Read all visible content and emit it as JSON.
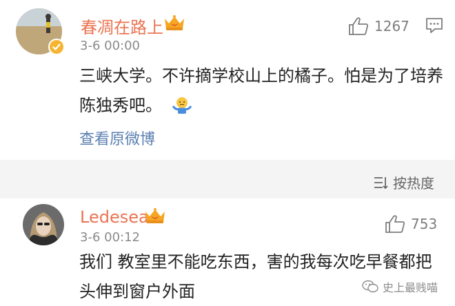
{
  "comments": [
    {
      "username": "春凋在路上",
      "time": "3-6 00:00",
      "likes": "1267",
      "text": "三峡大学。不许摘学校山上的橘子。怕是为了培养陈独秀吧。",
      "view_original": "查看原微博",
      "verified": true,
      "has_crown": true
    },
    {
      "username": "Ledesea",
      "time": "3-6 00:12",
      "likes": "753",
      "text": "我们 教室里不能吃东西，害的我每次吃早餐都把头伸到窗户外面",
      "has_crown": true
    }
  ],
  "sort": {
    "label": "按热度"
  },
  "watermark": {
    "text": "史上最贱喵"
  },
  "colors": {
    "username": "#eb7350",
    "link": "#5b7fb0",
    "meta": "#8a8a8a",
    "band": "#f4f4f4"
  },
  "icons": [
    "thumb-up-icon",
    "comment-icon",
    "crown-badge-icon",
    "verified-badge-icon",
    "shrug-emoji-icon",
    "sort-icon",
    "wechat-icon"
  ]
}
